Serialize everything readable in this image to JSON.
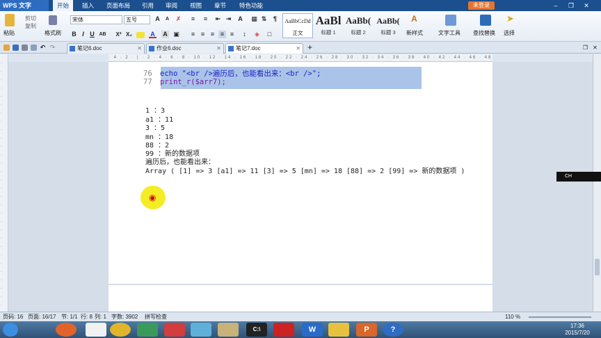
{
  "app": {
    "logo": "WPS 文字",
    "login": "未登录"
  },
  "menus": [
    "开始",
    "插入",
    "页面布局",
    "引用",
    "审阅",
    "视图",
    "章节",
    "特色功能"
  ],
  "ribbon": {
    "paste": "粘贴",
    "cut": "剪切",
    "copy": "复制",
    "format_painter": "格式刷",
    "font_name": "宋体",
    "font_size": "五号",
    "bold": "B",
    "italic": "I",
    "underline": "U",
    "styles": [
      {
        "preview": "AaBbCcDd",
        "label": "正文"
      },
      {
        "preview": "AaBl",
        "label": "标题 1"
      },
      {
        "preview": "AaBb(",
        "label": "标题 2"
      },
      {
        "preview": "AaBb(",
        "label": "标题 3"
      }
    ],
    "new_style": "新样式",
    "text_tools": "文字工具",
    "find_replace": "查找替换",
    "select": "选择"
  },
  "tabs": [
    {
      "label": "笔记6.doc"
    },
    {
      "label": "作业6.doc"
    },
    {
      "label": "笔记7.doc"
    }
  ],
  "document": {
    "code": [
      {
        "num": "76",
        "text": "echo \"<br />遍历后，也能看出来：<br />\";"
      },
      {
        "num": "77",
        "text": "print_r($arr7);"
      }
    ],
    "output": [
      "1 ：3",
      "a1 ：11",
      "3 ：5",
      "mn ：18",
      "88 ：2",
      "99 ：新的数据项",
      "遍历后，也能看出来：",
      "Array ( [1] => 3 [a1] => 11 [3] => 5 [mn] => 18 [88] => 2 [99] => 新的数据项 )"
    ]
  },
  "ime": "CH",
  "status": {
    "page": "页码: 16",
    "pages": "页面: 16/17",
    "section": "节: 1/1",
    "line": "行: 8",
    "col": "列: 1",
    "words": "字数: 3902",
    "spell": "拼写检查",
    "zoom": "110 %"
  },
  "clock": {
    "time": "17:36",
    "date": "2015/7/20"
  },
  "colors": {
    "accent": "#1b4f8e",
    "selection": "#a9c4e8"
  }
}
